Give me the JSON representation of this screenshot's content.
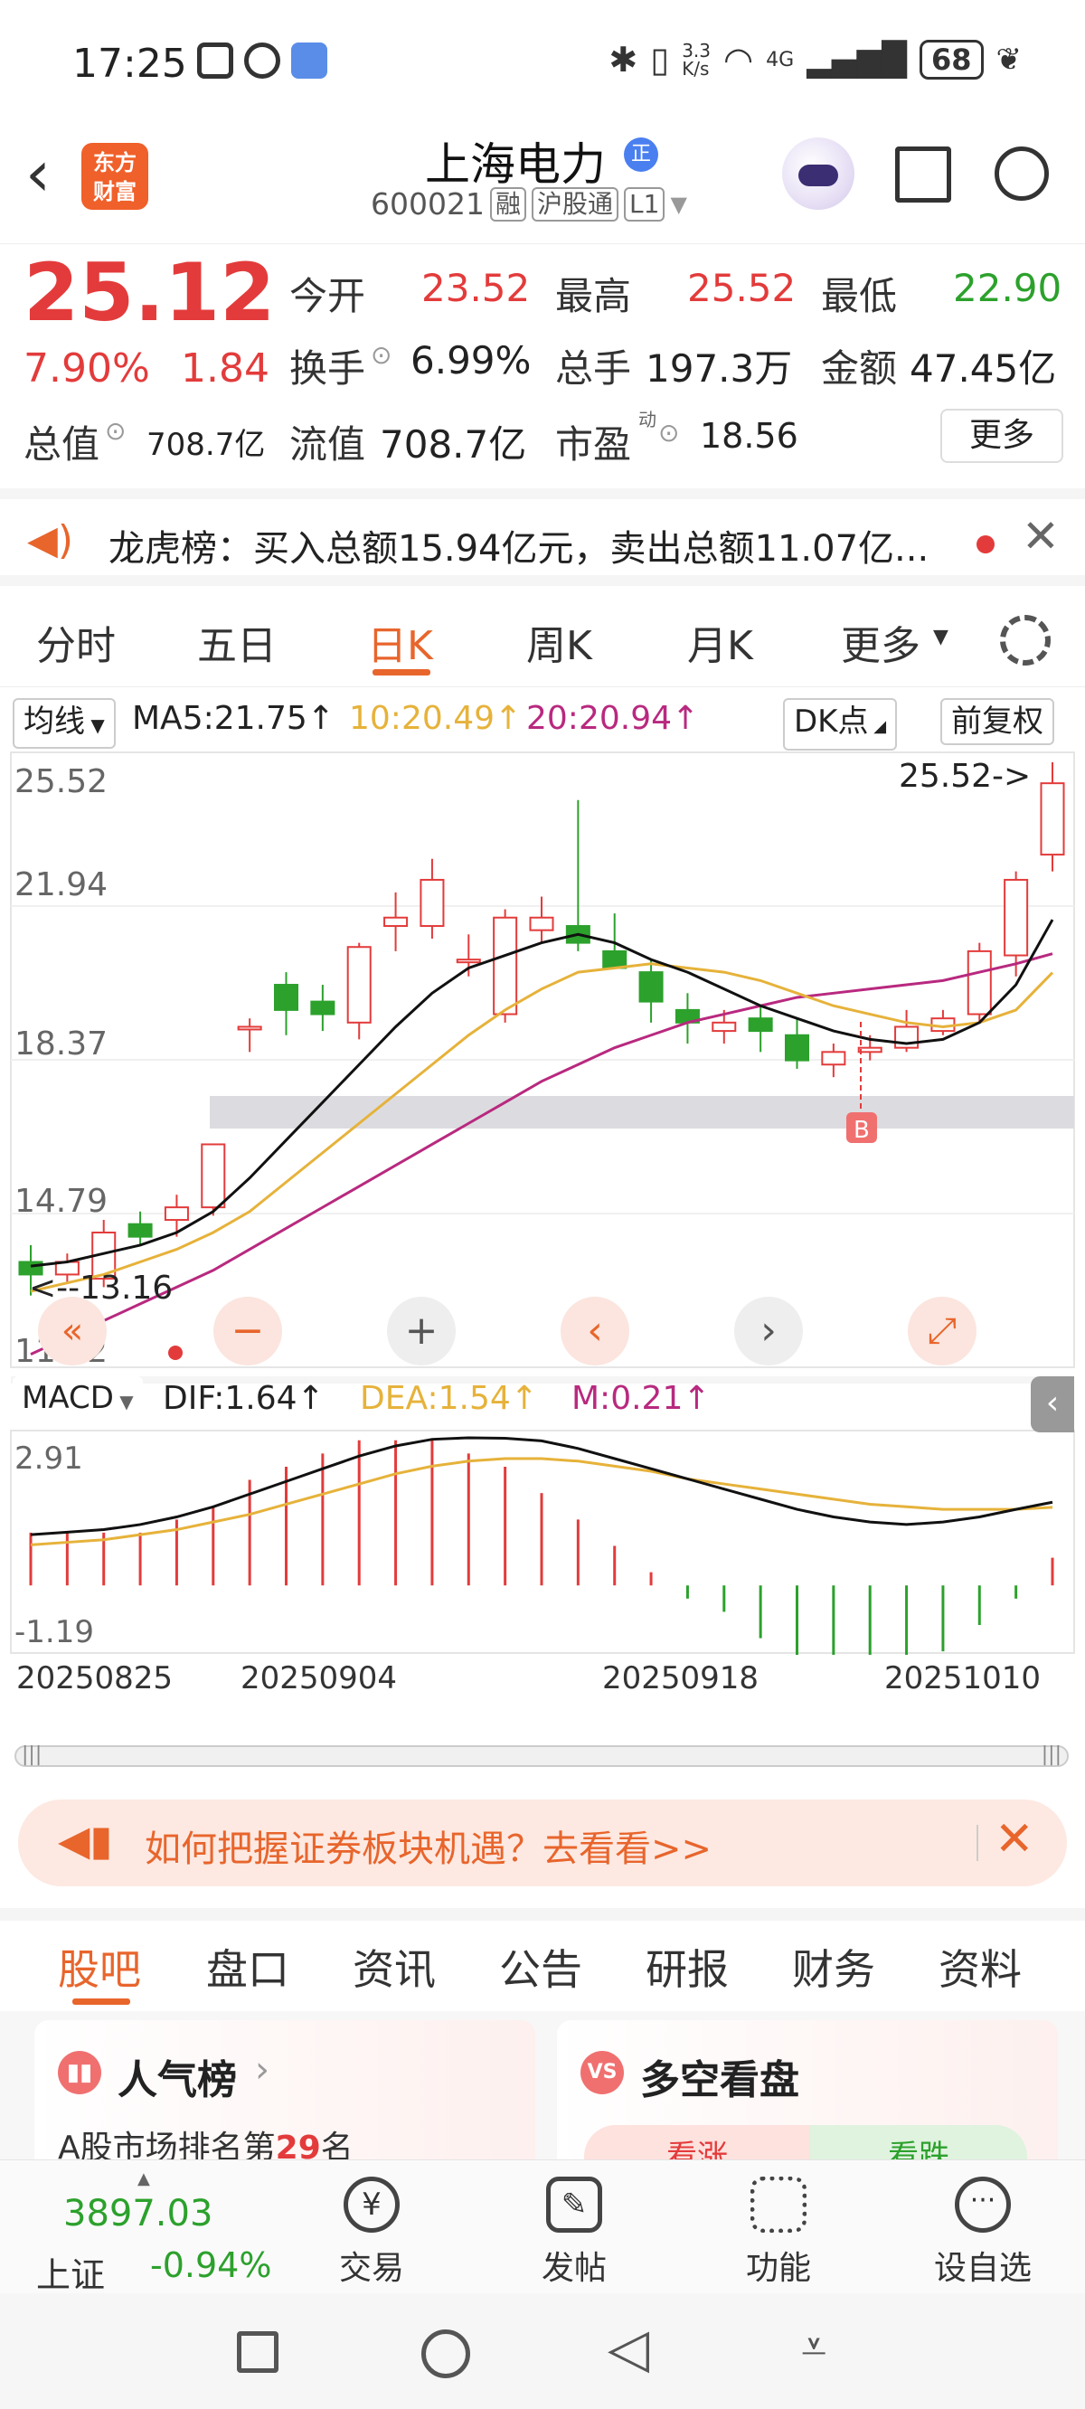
{
  "status": {
    "time": "17:25",
    "net_speed": "3.3\nK/s",
    "network": "4G",
    "battery": "68"
  },
  "header": {
    "logo_text": "东方\n财富",
    "name": "上海电力",
    "name_badge": "正",
    "code": "600021",
    "tag1": "融",
    "tag2": "沪股通",
    "tag3": "L1"
  },
  "quote": {
    "price": "25.12",
    "pct": "7.90%",
    "change": "1.84",
    "open_label": "今开",
    "open": "23.52",
    "high_label": "最高",
    "high": "25.52",
    "low_label": "最低",
    "low": "22.90",
    "turnover_label": "换手",
    "turnover": "6.99%",
    "volume_label": "总手",
    "volume": "197.3万",
    "amount_label": "金额",
    "amount": "47.45亿",
    "mcap_label": "总值",
    "mcap": "708.7亿",
    "float_label": "流值",
    "float": "708.7亿",
    "pe_label": "市盈",
    "pe_sup": "动",
    "pe": "18.56",
    "more": "更多"
  },
  "notice": {
    "text": "龙虎榜：买入总额15.94亿元，卖出总额11.07亿..."
  },
  "tabs": [
    "分时",
    "五日",
    "日K",
    "周K",
    "月K",
    "更多"
  ],
  "active_tab": "日K",
  "ma_bar": {
    "ma_select": "均线",
    "ma5": "MA5:21.75↑",
    "ma10": "10:20.49↑",
    "ma20": "20:20.94↑",
    "dk": "DK点",
    "fq": "前复权"
  },
  "macd_bar": {
    "macd_select": "MACD",
    "dif": "DIF:1.64↑",
    "dea": "DEA:1.54↑",
    "m": "M:0.21↑"
  },
  "chart_data": {
    "type": "candlestick",
    "y_ticks": [
      "25.52",
      "21.94",
      "18.37",
      "14.79",
      "11.22"
    ],
    "ylim": [
      11.22,
      25.52
    ],
    "max_label": "25.52->",
    "min_label": "<--13.16",
    "buy_marker": "B",
    "dates": [
      "20250825",
      "20250904",
      "20250918",
      "20251010"
    ],
    "candles": [
      {
        "o": 13.6,
        "c": 13.3,
        "h": 14.0,
        "l": 12.8
      },
      {
        "o": 13.3,
        "c": 13.6,
        "h": 13.8,
        "l": 13.1
      },
      {
        "o": 13.2,
        "c": 14.3,
        "h": 14.6,
        "l": 13.0
      },
      {
        "o": 14.5,
        "c": 14.2,
        "h": 14.8,
        "l": 14.0
      },
      {
        "o": 14.6,
        "c": 14.9,
        "h": 15.2,
        "l": 14.2
      },
      {
        "o": 14.9,
        "c": 16.4,
        "h": 16.4,
        "l": 14.7
      },
      {
        "o": 19.2,
        "c": 19.2,
        "h": 19.4,
        "l": 18.6
      },
      {
        "o": 20.2,
        "c": 19.6,
        "h": 20.5,
        "l": 19.0
      },
      {
        "o": 19.8,
        "c": 19.5,
        "h": 20.2,
        "l": 19.1
      },
      {
        "o": 19.3,
        "c": 21.1,
        "h": 21.2,
        "l": 18.9
      },
      {
        "o": 21.6,
        "c": 21.8,
        "h": 22.4,
        "l": 21.0
      },
      {
        "o": 21.6,
        "c": 22.7,
        "h": 23.2,
        "l": 21.3
      },
      {
        "o": 20.8,
        "c": 20.8,
        "h": 21.4,
        "l": 20.4
      },
      {
        "o": 19.5,
        "c": 21.8,
        "h": 22.0,
        "l": 19.3
      },
      {
        "o": 21.5,
        "c": 21.8,
        "h": 22.3,
        "l": 21.2
      },
      {
        "o": 21.6,
        "c": 21.2,
        "h": 24.6,
        "l": 21.0
      },
      {
        "o": 21.0,
        "c": 20.6,
        "h": 21.9,
        "l": 20.6
      },
      {
        "o": 20.5,
        "c": 19.8,
        "h": 20.8,
        "l": 19.3
      },
      {
        "o": 19.6,
        "c": 19.3,
        "h": 20.0,
        "l": 18.8
      },
      {
        "o": 19.1,
        "c": 19.3,
        "h": 19.6,
        "l": 18.8
      },
      {
        "o": 19.4,
        "c": 19.1,
        "h": 19.7,
        "l": 18.6
      },
      {
        "o": 19.0,
        "c": 18.4,
        "h": 19.4,
        "l": 18.2
      },
      {
        "o": 18.3,
        "c": 18.6,
        "h": 18.8,
        "l": 18.0
      },
      {
        "o": 18.6,
        "c": 18.7,
        "h": 19.0,
        "l": 18.4
      },
      {
        "o": 18.7,
        "c": 19.2,
        "h": 19.6,
        "l": 18.6
      },
      {
        "o": 19.1,
        "c": 19.4,
        "h": 19.6,
        "l": 19.0
      },
      {
        "o": 19.5,
        "c": 21.0,
        "h": 21.2,
        "l": 19.3
      },
      {
        "o": 20.9,
        "c": 22.7,
        "h": 22.9,
        "l": 20.4
      },
      {
        "o": 23.3,
        "c": 25.0,
        "h": 25.5,
        "l": 22.9
      }
    ],
    "ma5": [
      13.5,
      13.6,
      13.8,
      14.0,
      14.3,
      14.8,
      15.6,
      16.5,
      17.4,
      18.3,
      19.2,
      20.0,
      20.6,
      20.9,
      21.2,
      21.4,
      21.2,
      20.8,
      20.5,
      20.1,
      19.7,
      19.4,
      19.1,
      18.9,
      18.8,
      18.9,
      19.3,
      20.2,
      21.75
    ],
    "ma10": [
      12.9,
      13.1,
      13.3,
      13.6,
      13.9,
      14.3,
      14.8,
      15.5,
      16.2,
      16.9,
      17.6,
      18.3,
      19.0,
      19.6,
      20.1,
      20.5,
      20.6,
      20.7,
      20.6,
      20.5,
      20.3,
      20.0,
      19.7,
      19.5,
      19.3,
      19.2,
      19.3,
      19.6,
      20.49
    ],
    "ma20": [
      11.4,
      11.8,
      12.2,
      12.6,
      13.0,
      13.4,
      13.9,
      14.4,
      14.9,
      15.4,
      15.9,
      16.4,
      16.9,
      17.4,
      17.9,
      18.3,
      18.7,
      19.0,
      19.3,
      19.5,
      19.7,
      19.9,
      20.0,
      20.1,
      20.2,
      20.3,
      20.5,
      20.7,
      20.94
    ],
    "macd": {
      "ylim": [
        -1.19,
        2.91
      ],
      "dif": [
        1.0,
        1.05,
        1.1,
        1.2,
        1.35,
        1.55,
        1.8,
        2.05,
        2.3,
        2.55,
        2.75,
        2.88,
        2.91,
        2.9,
        2.85,
        2.7,
        2.5,
        2.3,
        2.1,
        1.9,
        1.7,
        1.5,
        1.35,
        1.25,
        1.2,
        1.25,
        1.35,
        1.5,
        1.64
      ],
      "dea": [
        0.8,
        0.85,
        0.9,
        1.0,
        1.1,
        1.25,
        1.4,
        1.6,
        1.8,
        2.0,
        2.2,
        2.35,
        2.45,
        2.5,
        2.5,
        2.45,
        2.35,
        2.25,
        2.1,
        2.0,
        1.9,
        1.8,
        1.7,
        1.6,
        1.55,
        1.5,
        1.5,
        1.5,
        1.54
      ],
      "m": [
        0.4,
        0.4,
        0.4,
        0.4,
        0.5,
        0.6,
        0.8,
        0.9,
        1.0,
        1.1,
        1.1,
        1.1,
        1.0,
        0.9,
        0.7,
        0.5,
        0.3,
        0.1,
        -0.1,
        -0.2,
        -0.4,
        -0.6,
        -0.7,
        -0.7,
        -0.7,
        -0.5,
        -0.3,
        -0.1,
        0.21
      ]
    },
    "macd_ticks": [
      "2.91",
      "-1.19"
    ]
  },
  "ad": {
    "text": "如何把握证券板块机遇？去看看>>"
  },
  "subtabs": [
    "股吧",
    "盘口",
    "资讯",
    "公告",
    "研报",
    "财务",
    "资料"
  ],
  "active_subtab": "股吧",
  "cards": {
    "c1_title": "人气榜",
    "c1_sub_prefix": "A股市场排名第",
    "c1_rank": "29",
    "c1_sub_suffix": "名",
    "c2_icon": "VS",
    "c2_title": "多空看盘",
    "c2_up": "看涨",
    "c2_down": "看跌"
  },
  "bottom": {
    "index_val": "3897.03",
    "index_name": "上证",
    "index_pct": "-0.94%",
    "trade": "交易",
    "post": "发帖",
    "func": "功能",
    "watch": "设自选"
  }
}
